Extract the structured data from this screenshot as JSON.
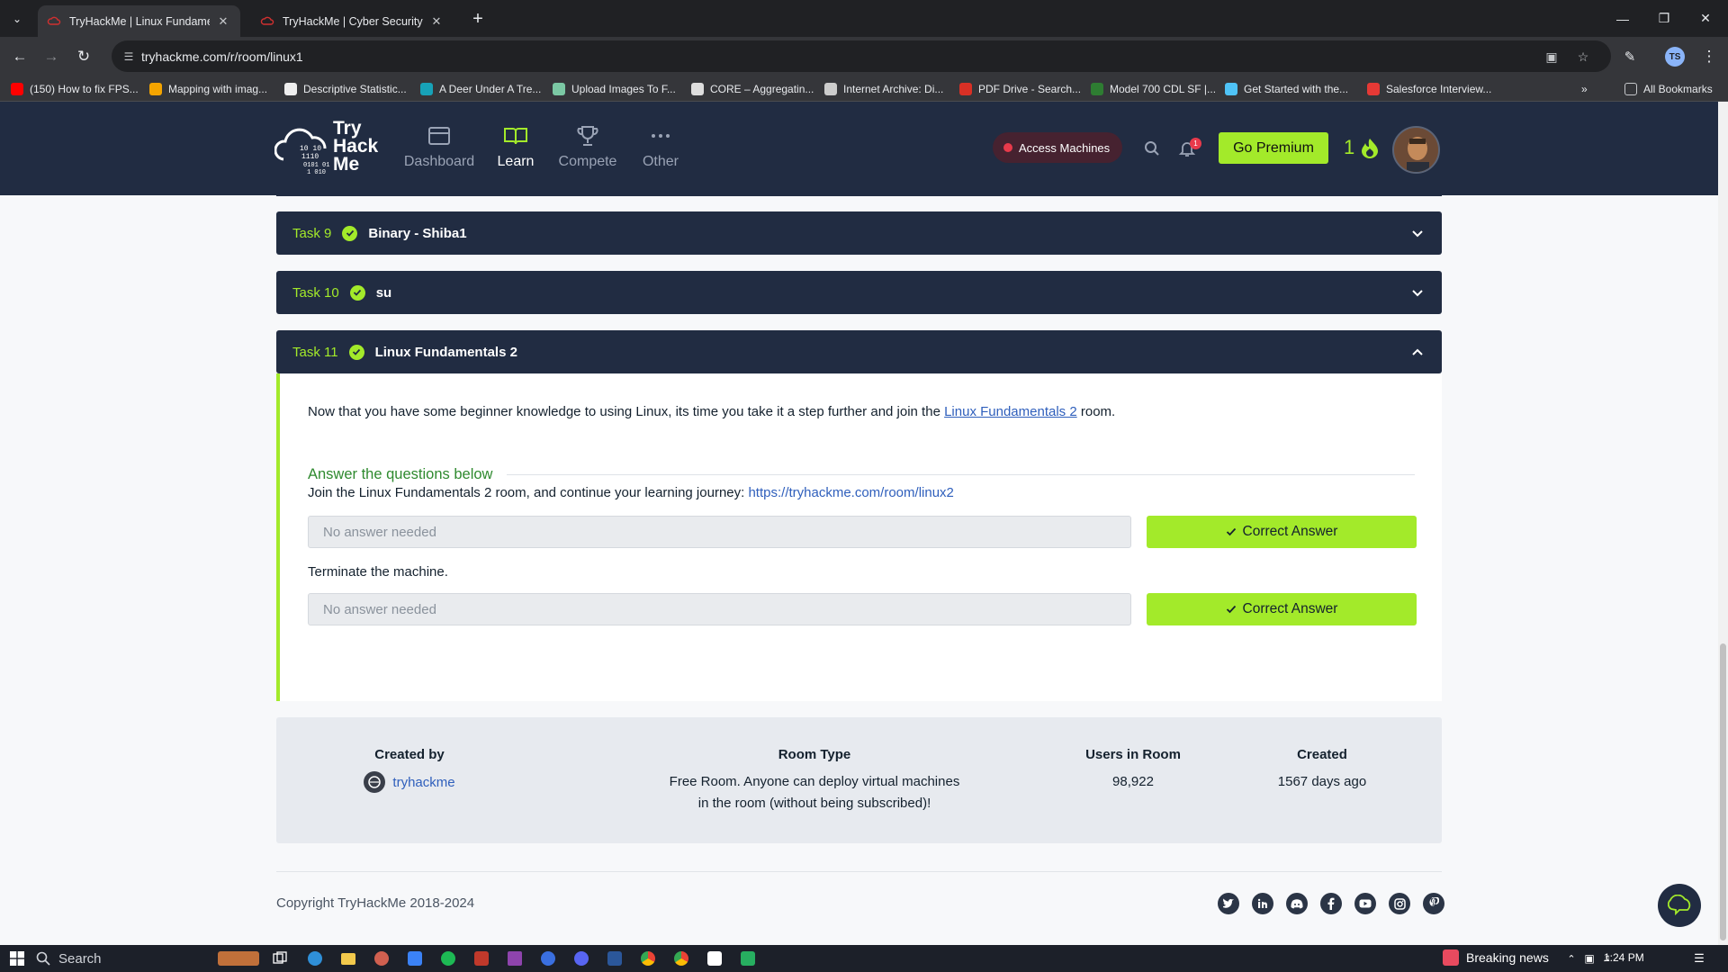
{
  "browser": {
    "tabs": [
      {
        "title": "TryHackMe | Linux Fundamentals",
        "active": true
      },
      {
        "title": "TryHackMe | Cyber Security Training",
        "active": false
      }
    ],
    "url": "tryhackme.com/r/room/linux1",
    "bookmarks": [
      {
        "label": "(150) How to fix FPS...",
        "color": "#ff0000"
      },
      {
        "label": "Mapping with imag...",
        "color": "#f4a400"
      },
      {
        "label": "Descriptive Statistic...",
        "color": "#eeeeee"
      },
      {
        "label": "A Deer Under A Tre...",
        "color": "#17a2b8"
      },
      {
        "label": "Upload Images To F...",
        "color": "#7bc8a4"
      },
      {
        "label": "CORE – Aggregatin...",
        "color": "#dddddd"
      },
      {
        "label": "Internet Archive: Di...",
        "color": "#cccccc"
      },
      {
        "label": "PDF Drive - Search...",
        "color": "#d93025"
      },
      {
        "label": "Model 700 CDL SF |...",
        "color": "#2e7d32"
      },
      {
        "label": "Get Started with the...",
        "color": "#4fc3f7"
      },
      {
        "label": "Salesforce Interview...",
        "color": "#e53935"
      }
    ],
    "all_bookmarks": "All Bookmarks",
    "profile_initials": "TS"
  },
  "nav": {
    "logo_text": [
      "Try",
      "Hack",
      "Me"
    ],
    "items": [
      {
        "label": "Dashboard",
        "icon": "dashboard-icon",
        "active": false
      },
      {
        "label": "Learn",
        "icon": "book-icon",
        "active": true
      },
      {
        "label": "Compete",
        "icon": "trophy-icon",
        "active": false
      },
      {
        "label": "Other",
        "icon": "more-icon",
        "active": false
      }
    ],
    "access_machines": "Access Machines",
    "notification_count": "1",
    "go_premium": "Go Premium",
    "streak": "1"
  },
  "tasks": [
    {
      "number": "Task 9",
      "title": "Binary - Shiba1",
      "expanded": false
    },
    {
      "number": "Task 10",
      "title": "su",
      "expanded": false
    },
    {
      "number": "Task 11",
      "title": "Linux Fundamentals 2",
      "expanded": true
    }
  ],
  "task11": {
    "intro_before": "Now that you have some beginner knowledge to using Linux, its time you take it a step further and join the ",
    "intro_link": "Linux Fundamentals 2",
    "intro_after": " room.",
    "answer_heading": "Answer the questions below",
    "questions": [
      {
        "text": "Join the Linux Fundamentals 2 room, and continue your learning journey: ",
        "link": "https://tryhackme.com/room/linux2",
        "placeholder": "No answer needed",
        "button": "Correct Answer"
      },
      {
        "text": "Terminate the machine.",
        "link": "",
        "placeholder": "No answer needed",
        "button": "Correct Answer"
      }
    ]
  },
  "room_info": {
    "created_by_label": "Created by",
    "created_by_value": "tryhackme",
    "room_type_label": "Room Type",
    "room_type_line1": "Free Room. Anyone can deploy virtual machines",
    "room_type_line2": "in the room (without being subscribed)!",
    "users_label": "Users in Room",
    "users_value": "98,922",
    "created_label": "Created",
    "created_value": "1567 days ago"
  },
  "footer": {
    "copyright": "Copyright TryHackMe 2018-2024",
    "social": [
      "twitter-icon",
      "linkedin-icon",
      "discord-icon",
      "facebook-icon",
      "youtube-icon",
      "instagram-icon",
      "pinterest-icon"
    ]
  },
  "taskbar": {
    "search": "Search",
    "news": "Breaking news",
    "time": "1:24 PM"
  },
  "colors": {
    "nav_bg": "#212c42",
    "accent_green": "#a3ea2a",
    "link_blue": "#2f5fbc"
  }
}
